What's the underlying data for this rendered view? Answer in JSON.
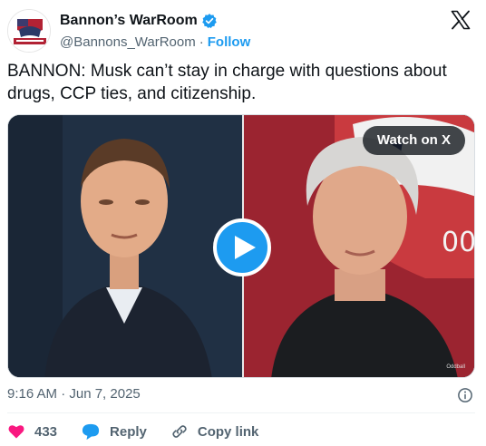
{
  "account": {
    "display_name": "Bannon’s WarRoom",
    "handle": "@Bannons_WarRoom",
    "separator": "·",
    "follow_label": "Follow"
  },
  "post": {
    "text": "BANNON: Musk can’t stay in charge with questions about drugs, CCP ties, and citizenship.",
    "timestamp": "9:16 AM · Jun 7, 2025"
  },
  "media": {
    "watch_label": "Watch on X",
    "overlay_text": "00",
    "watermark": "Oddball"
  },
  "actions": {
    "like_count": "433",
    "reply_label": "Reply",
    "copy_label": "Copy link"
  },
  "colors": {
    "accent": "#1d9bf0",
    "like": "#f91880",
    "text": "#0f1419",
    "muted": "#536471"
  },
  "icons": [
    "verified-badge-icon",
    "x-logo-icon",
    "play-icon",
    "info-icon",
    "heart-icon",
    "reply-icon",
    "link-icon"
  ]
}
